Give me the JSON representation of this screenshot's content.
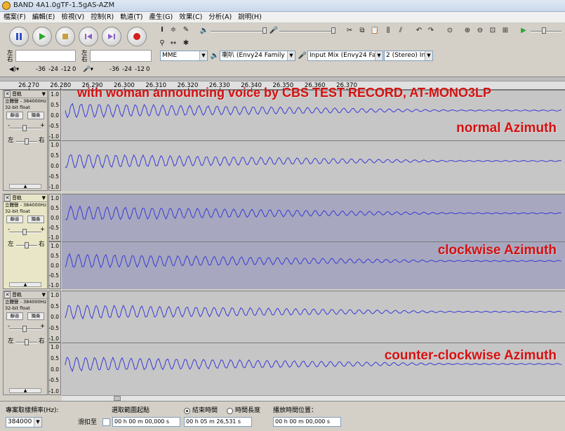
{
  "window": {
    "title": "BAND 4A1.0gTF-1.5gAS-AZM"
  },
  "menu": [
    "檔案(F)",
    "編輯(E)",
    "檢視(V)",
    "控制(R)",
    "軌道(T)",
    "產生(G)",
    "效果(C)",
    "分析(A)",
    "說明(H)"
  ],
  "meters": {
    "left_label": "左",
    "right_label": "右",
    "scale": [
      "-36",
      "-24",
      "-12",
      "0"
    ]
  },
  "devices": {
    "host": "MME",
    "output": "喇叭 (Envy24 Family",
    "input": "Input Mix (Envy24 Fa",
    "channels": "2 (Stereo) In"
  },
  "ruler": {
    "ticks": [
      "26.270",
      "26.280",
      "26.290",
      "26.300",
      "26.310",
      "26.320",
      "26.330",
      "26.340",
      "26.350",
      "26.360",
      "26.370"
    ]
  },
  "track_panel": {
    "name": "音軌",
    "info1": "立體聲 - 384000Hz",
    "info2": "32-bit float",
    "mute": "靜音",
    "solo": "獨奏",
    "gain_minus": "-",
    "gain_plus": "+",
    "pan_left": "左",
    "pan_right": "右"
  },
  "amp_scale": [
    "1.0",
    "0.5",
    "0.0",
    "-0.5",
    "-1.0"
  ],
  "tracks": [
    {
      "annotation": "normal Azimuth",
      "selected": false
    },
    {
      "annotation": "clockwise Azimuth",
      "selected": true
    },
    {
      "annotation": "counter-clockwise Azimuth",
      "selected": false
    }
  ],
  "header_annotation": "with woman announcing voice by CBS TEST RECORD, AT-MONO3LP",
  "bottom": {
    "rate_label": "專案取樣頻率(Hz):",
    "rate_value": "384000",
    "snap_label": "滑扣至",
    "selection_start_label": "選取範圍起點",
    "end_label": "結束時間",
    "length_label": "時間長度",
    "audio_pos_label": "播放時間位置：",
    "start_value": "00 h 00 m 00,000 s",
    "end_value": "00 h 05 m 26,531 s",
    "pos_value": "00 h 00 m 00,000 s"
  },
  "colors": {
    "wave": "#3838d8",
    "annotation": "#d51010",
    "track_bg": "#c6c6c6",
    "selected_bg": "#a7a7bf"
  }
}
